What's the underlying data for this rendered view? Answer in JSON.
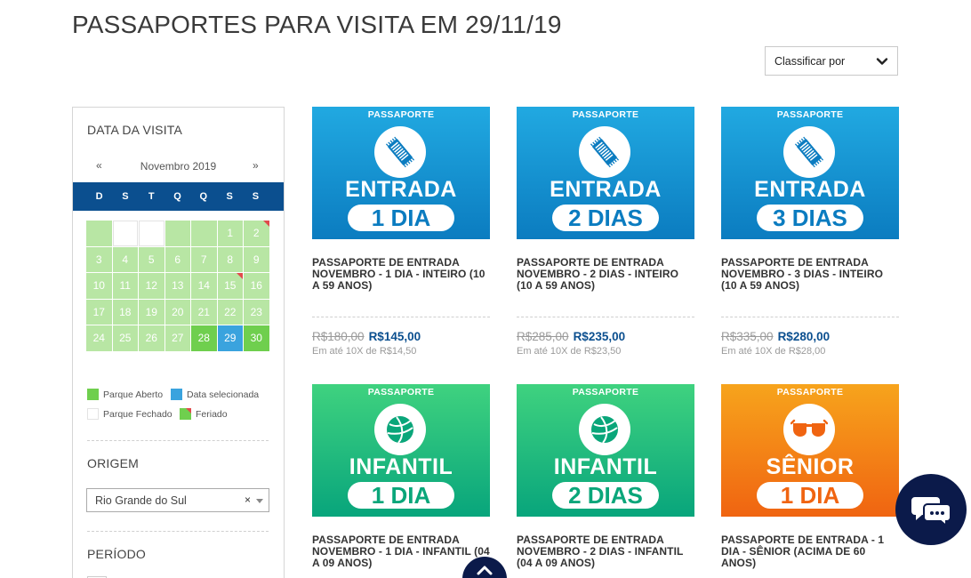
{
  "page_title": "PASSAPORTES PARA VISITA EM 29/11/19",
  "sort": {
    "label": "Classificar por"
  },
  "sidebar": {
    "visit_title": "DATA DA VISITA",
    "calendar": {
      "prev": "«",
      "next": "»",
      "month": "Novembro 2019",
      "weekdays": [
        "D",
        "S",
        "T",
        "Q",
        "Q",
        "S",
        "S"
      ],
      "days": [
        {
          "label": "",
          "state": "emptygreen"
        },
        {
          "label": "",
          "state": "empty"
        },
        {
          "label": "",
          "state": "empty"
        },
        {
          "label": "",
          "state": "emptygreen"
        },
        {
          "label": "",
          "state": "emptygreen"
        },
        {
          "label": "1",
          "state": "open"
        },
        {
          "label": "2",
          "state": "holiday"
        },
        {
          "label": "3",
          "state": "open"
        },
        {
          "label": "4",
          "state": "open"
        },
        {
          "label": "5",
          "state": "open"
        },
        {
          "label": "6",
          "state": "open"
        },
        {
          "label": "7",
          "state": "open"
        },
        {
          "label": "8",
          "state": "open"
        },
        {
          "label": "9",
          "state": "open"
        },
        {
          "label": "10",
          "state": "open"
        },
        {
          "label": "11",
          "state": "open"
        },
        {
          "label": "12",
          "state": "open"
        },
        {
          "label": "13",
          "state": "open"
        },
        {
          "label": "14",
          "state": "open"
        },
        {
          "label": "15",
          "state": "holiday"
        },
        {
          "label": "16",
          "state": "open"
        },
        {
          "label": "17",
          "state": "open"
        },
        {
          "label": "18",
          "state": "open"
        },
        {
          "label": "19",
          "state": "open"
        },
        {
          "label": "20",
          "state": "open"
        },
        {
          "label": "21",
          "state": "open"
        },
        {
          "label": "22",
          "state": "open"
        },
        {
          "label": "23",
          "state": "open"
        },
        {
          "label": "24",
          "state": "open"
        },
        {
          "label": "25",
          "state": "open"
        },
        {
          "label": "26",
          "state": "open"
        },
        {
          "label": "27",
          "state": "open"
        },
        {
          "label": "28",
          "state": "today"
        },
        {
          "label": "29",
          "state": "selected"
        },
        {
          "label": "30",
          "state": "today"
        }
      ]
    },
    "legend": {
      "open": "Parque Aberto",
      "selected": "Data selecionada",
      "closed": "Parque Fechado",
      "holiday": "Feriado"
    },
    "origem": {
      "title": "ORIGEM",
      "value": "Rio Grande do Sul",
      "clear": "×"
    },
    "periodo": {
      "title": "PERÍODO"
    }
  },
  "products": [
    {
      "tag": "PASSAPORTE",
      "word": "ENTRADA",
      "pill": "1 DIA",
      "theme": "blue",
      "icon": "ticket-icon",
      "name": "PASSAPORTE DE ENTRADA NOVEMBRO - 1 DIA - INTEIRO (10 A 59 ANOS)",
      "old_price": "R$180,00",
      "new_price": "R$145,00",
      "installments": "Em até 10X de R$14,50"
    },
    {
      "tag": "PASSAPORTE",
      "word": "ENTRADA",
      "pill": "2 DIAS",
      "theme": "blue",
      "icon": "ticket-icon",
      "name": "PASSAPORTE DE ENTRADA NOVEMBRO - 2 DIAS - INTEIRO (10 A 59 ANOS)",
      "old_price": "R$285,00",
      "new_price": "R$235,00",
      "installments": "Em até 10X de R$23,50"
    },
    {
      "tag": "PASSAPORTE",
      "word": "ENTRADA",
      "pill": "3 DIAS",
      "theme": "blue",
      "icon": "ticket-icon",
      "name": "PASSAPORTE DE ENTRADA NOVEMBRO - 3 DIAS - INTEIRO (10 A 59 ANOS)",
      "old_price": "R$335,00",
      "new_price": "R$280,00",
      "installments": "Em até 10X de R$28,00"
    },
    {
      "tag": "PASSAPORTE",
      "word": "INFANTIL",
      "pill": "1 DIA",
      "theme": "green",
      "icon": "ball-icon",
      "name": "PASSAPORTE DE ENTRADA NOVEMBRO - 1 DIA - INFANTIL (04 A 09 ANOS)"
    },
    {
      "tag": "PASSAPORTE",
      "word": "INFANTIL",
      "pill": "2 DIAS",
      "theme": "green",
      "icon": "ball-icon",
      "name": "PASSAPORTE DE ENTRADA NOVEMBRO - 2 DIAS - INFANTIL (04 A 09 ANOS)"
    },
    {
      "tag": "PASSAPORTE",
      "word": "SÊNIOR",
      "pill": "1 DIA",
      "theme": "orange",
      "icon": "glasses-icon",
      "name": "PASSAPORTE DE ENTRADA - 1 DIA - SÊNIOR (ACIMA DE 60 ANOS)"
    }
  ],
  "colors": {
    "brand_navy": "#0b4f8f",
    "open": "#b8e6a4",
    "selected": "#3aa3de",
    "chat": "#0b1a4a"
  }
}
